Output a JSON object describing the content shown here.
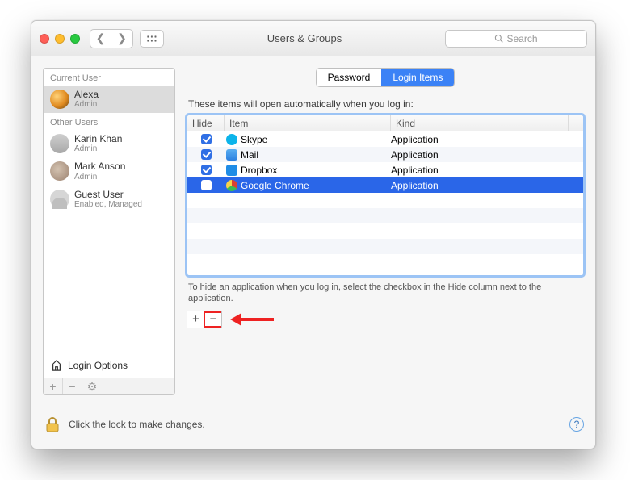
{
  "window": {
    "title": "Users & Groups"
  },
  "toolbar": {
    "search_placeholder": "Search"
  },
  "sidebar": {
    "current_user_header": "Current User",
    "other_users_header": "Other Users",
    "login_options_label": "Login Options",
    "users": [
      {
        "name": "Alexa",
        "role": "Admin",
        "selected": true,
        "avatar": "orange"
      },
      {
        "name": "Karin Khan",
        "role": "Admin",
        "selected": false,
        "avatar": "kk"
      },
      {
        "name": "Mark Anson",
        "role": "Admin",
        "selected": false,
        "avatar": "ma"
      },
      {
        "name": "Guest User",
        "role": "Enabled, Managed",
        "selected": false,
        "avatar": "silhouette"
      }
    ]
  },
  "tabs": {
    "password": "Password",
    "login_items": "Login Items"
  },
  "main": {
    "caption": "These items will open automatically when you log in:",
    "hint": "To hide an application when you log in, select the checkbox in the Hide column next to the application.",
    "columns": {
      "hide": "Hide",
      "item": "Item",
      "kind": "Kind"
    },
    "rows": [
      {
        "hide": true,
        "name": "Skype",
        "kind": "Application",
        "icon": "ic-skype",
        "selected": false
      },
      {
        "hide": true,
        "name": "Mail",
        "kind": "Application",
        "icon": "ic-mail",
        "selected": false
      },
      {
        "hide": true,
        "name": "Dropbox",
        "kind": "Application",
        "icon": "ic-dropbox",
        "selected": false
      },
      {
        "hide": false,
        "name": "Google Chrome",
        "kind": "Application",
        "icon": "ic-chrome",
        "selected": true
      }
    ]
  },
  "footer": {
    "lock_text": "Click the lock to make changes.",
    "help": "?"
  }
}
